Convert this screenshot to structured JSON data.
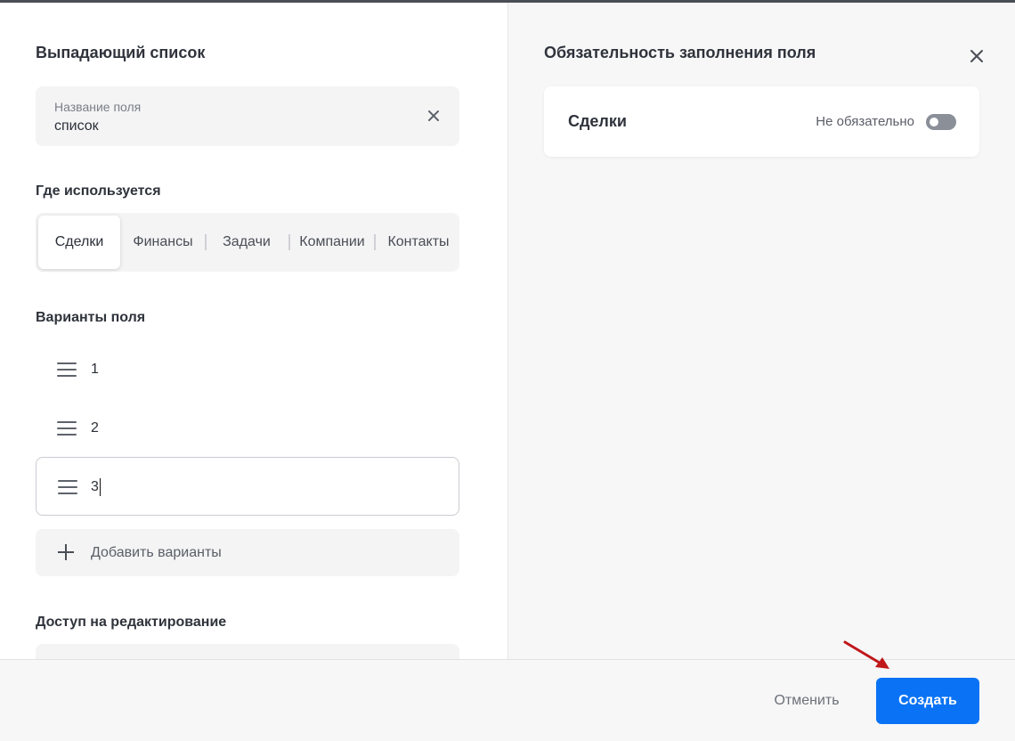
{
  "left_panel": {
    "title": "Выпадающий список",
    "name_field": {
      "label": "Название поля",
      "value": "список"
    },
    "where_used": {
      "title": "Где используется",
      "tabs": [
        {
          "label": "Сделки",
          "active": true
        },
        {
          "label": "Финансы",
          "active": false
        },
        {
          "label": "Задачи",
          "active": false
        },
        {
          "label": "Компании",
          "active": false
        },
        {
          "label": "Контакты",
          "active": false
        }
      ]
    },
    "variants": {
      "title": "Варианты поля",
      "items": [
        "1",
        "2",
        "3"
      ],
      "add_label": "Добавить варианты"
    },
    "access": {
      "title": "Доступ на редактирование"
    }
  },
  "right_panel": {
    "title": "Обязательность заполнения поля",
    "cards": [
      {
        "name": "Сделки",
        "state": "Не обязательно",
        "required": false
      }
    ]
  },
  "footer": {
    "cancel_label": "Отменить",
    "create_label": "Создать"
  },
  "colors": {
    "accent": "#0a73f5",
    "annotation_arrow": "#c0181b",
    "toggle_off": "#8a8f98"
  }
}
